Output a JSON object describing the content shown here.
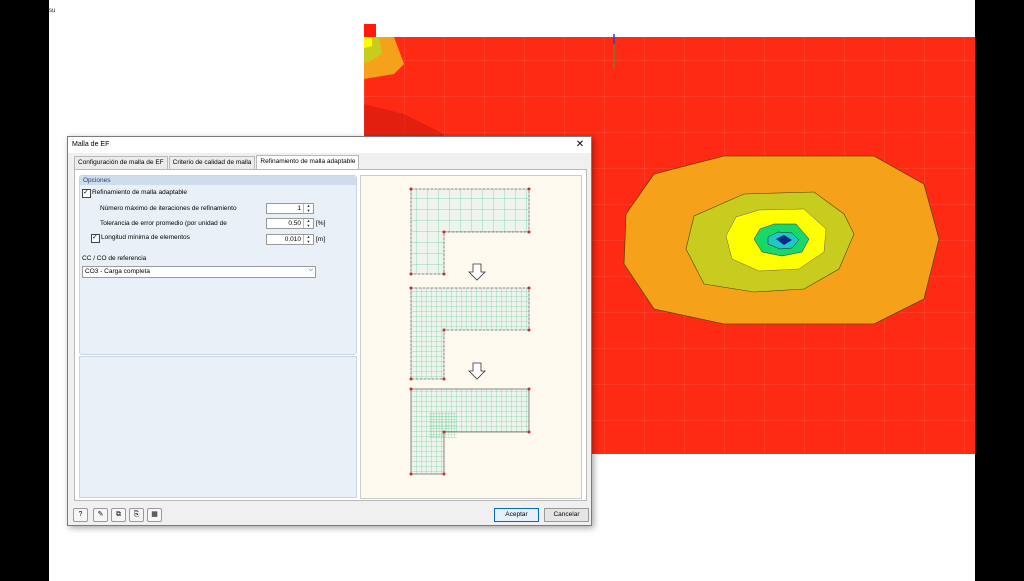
{
  "corner_label": "su",
  "dialog": {
    "title": "Malla de EF",
    "close_icon": "close-icon",
    "tabs": [
      {
        "label": "Configuración de malla de EF",
        "active": false
      },
      {
        "label": "Criterio de calidad de malla",
        "active": false
      },
      {
        "label": "Refinamiento de malla adaptable",
        "active": true
      }
    ],
    "options": {
      "title": "Opciones",
      "adaptive_refinement": {
        "label": "Refinamiento de malla adaptable",
        "checked": true
      },
      "max_iterations": {
        "label": "Número máximo de iteraciones de refinamiento",
        "value": "1"
      },
      "tolerance": {
        "label": "Tolerancia de error promedio (por unidad de",
        "value": "0.50",
        "unit": "[%]"
      },
      "min_length": {
        "label": "Longitud mínima de elementos",
        "checked": true,
        "value": "0.010",
        "unit": "[m]"
      },
      "reference_label": "CC / CO de referencia",
      "reference_value": "CO3 - Carga completa"
    },
    "toolbar_icons": [
      "help-icon",
      "edit-icon",
      "copy-icon",
      "paste-icon",
      "units-icon"
    ],
    "ok_label": "Aceptar",
    "cancel_label": "Cancelar"
  },
  "colors": {
    "field_red": "#ff2a14",
    "orange": "#f5a11a",
    "olive": "#c8cc1e",
    "yellow": "#ffff00",
    "green": "#18d86a",
    "cyan": "#1ec8c4",
    "blue": "#0c2a8a",
    "mesh_green": "#29c26e"
  }
}
